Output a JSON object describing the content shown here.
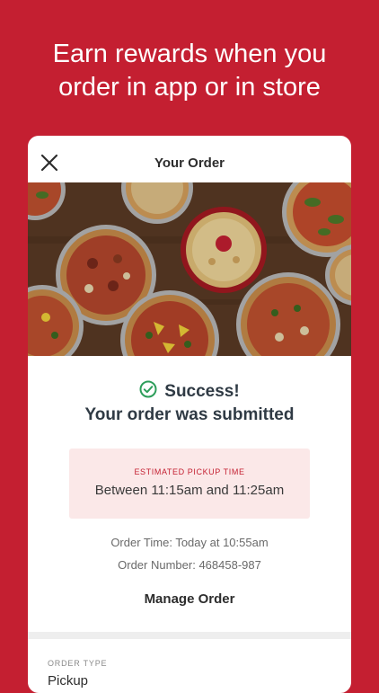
{
  "promo": {
    "line1": "Earn rewards when you",
    "line2": "order in app or in store"
  },
  "header": {
    "title": "Your Order",
    "close_icon": "close-icon"
  },
  "hero": {
    "image": "pizza-table-photo"
  },
  "confirmation": {
    "status": "Success!",
    "message": "Your order was submitted",
    "status_icon": "check-circle-icon",
    "status_color": "#2e9e5b"
  },
  "pickup": {
    "label": "ESTIMATED PICKUP TIME",
    "time": "Between 11:15am and 11:25am"
  },
  "details": {
    "order_time": "Order Time: Today at 10:55am",
    "order_number": "Order Number: 468458-987"
  },
  "actions": {
    "manage_label": "Manage Order"
  },
  "order_type": {
    "label": "ORDER TYPE",
    "value": "Pickup"
  },
  "colors": {
    "brand": "#c41f31",
    "pickup_bg": "#fbe8e8",
    "card_bg": "#ffffff"
  }
}
